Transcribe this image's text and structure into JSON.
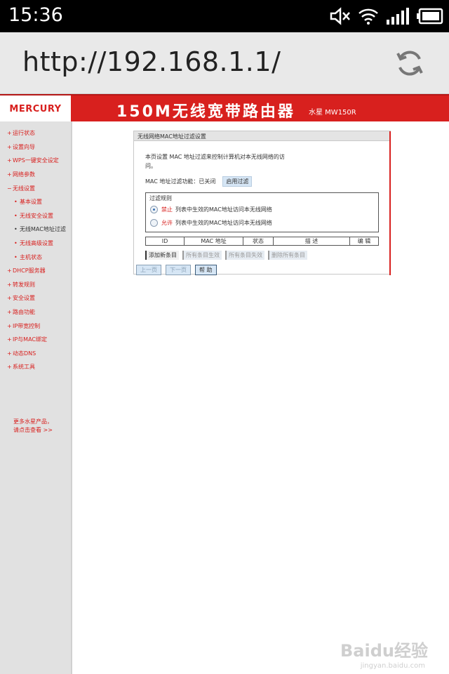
{
  "status_bar": {
    "time": "15:36"
  },
  "browser": {
    "url": "http://192.168.1.1/"
  },
  "banner": {
    "logo": "MERCURY",
    "title": "150M无线宽带路由器",
    "model": "水星 MW150R"
  },
  "sidebar": {
    "items": [
      {
        "label": "运行状态",
        "bullet": "+"
      },
      {
        "label": "设置向导",
        "bullet": "+"
      },
      {
        "label": "WPS一键安全设定",
        "bullet": "+"
      },
      {
        "label": "网络参数",
        "bullet": "+"
      },
      {
        "label": "无线设置",
        "bullet": "−"
      },
      {
        "label": "基本设置",
        "bullet": "•"
      },
      {
        "label": "无线安全设置",
        "bullet": "•"
      },
      {
        "label": "无线MAC地址过滤",
        "bullet": "•"
      },
      {
        "label": "无线高级设置",
        "bullet": "•"
      },
      {
        "label": "主机状态",
        "bullet": "•"
      },
      {
        "label": "DHCP服务器",
        "bullet": "+"
      },
      {
        "label": "转发规则",
        "bullet": "+"
      },
      {
        "label": "安全设置",
        "bullet": "+"
      },
      {
        "label": "路由功能",
        "bullet": "+"
      },
      {
        "label": "IP带宽控制",
        "bullet": "+"
      },
      {
        "label": "IP与MAC绑定",
        "bullet": "+"
      },
      {
        "label": "动态DNS",
        "bullet": "+"
      },
      {
        "label": "系统工具",
        "bullet": "+"
      }
    ],
    "promo_line1": "更多水星产品，",
    "promo_line2": "请点击查看 >>"
  },
  "panel": {
    "title": "无线网络MAC地址过滤设置",
    "desc_line1": "本页设置 MAC 地址过滤来控制计算机对本无线网络的访",
    "desc_line2": "问。",
    "mac_status": "MAC 地址过滤功能：已关闭",
    "enable_button": "启用过滤",
    "rules_title": "过滤规则",
    "rule_deny_key": "禁止",
    "rule_deny_text": "列表中生效的MAC地址访问本无线网络",
    "rule_allow_key": "允许",
    "rule_allow_text": "列表中生效的MAC地址访问本无线网络",
    "table_headers": [
      "ID",
      "MAC 地址",
      "状态",
      "描 述",
      "编 辑"
    ],
    "actions": [
      "添加新条目",
      "所有条目生效",
      "所有条目失效",
      "删除所有条目"
    ],
    "nav": [
      "上一页",
      "下一页",
      "帮 助"
    ]
  },
  "watermark": {
    "text": "Baidu经验",
    "sub": "jingyan.baidu.com"
  }
}
